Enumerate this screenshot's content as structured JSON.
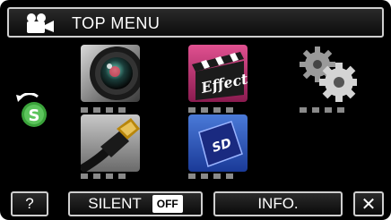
{
  "title": {
    "text": "TOP MENU",
    "icon": "video-camera-icon"
  },
  "tiles": [
    {
      "name": "camera-lens-tile",
      "icon": "camera-lens-icon"
    },
    {
      "name": "effect-tile",
      "icon": "effect-clapper-icon",
      "label": "Effect"
    },
    {
      "name": "settings-gear-tile",
      "icon": "gear-icon"
    },
    {
      "name": "hdmi-cable-tile",
      "icon": "hdmi-cable-icon"
    },
    {
      "name": "sd-card-tile",
      "icon": "sd-card-icon",
      "label": "SD"
    }
  ],
  "side_icon": {
    "name": "recycle-s-icon",
    "letter": "S"
  },
  "bottom": {
    "help_label": "?",
    "silent_label": "SILENT",
    "silent_state": "OFF",
    "info_label": "INFO.",
    "close_label": "✕"
  }
}
